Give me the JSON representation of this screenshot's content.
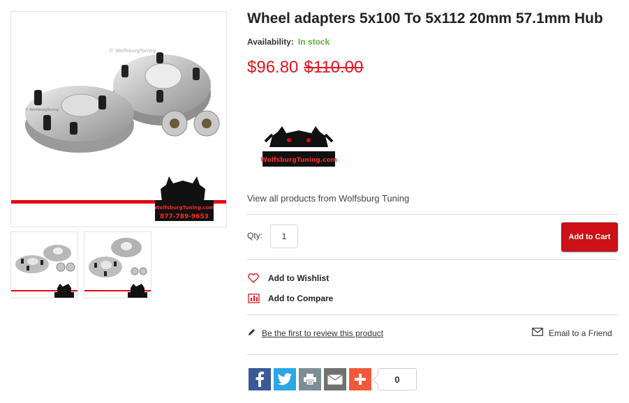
{
  "product": {
    "title": "Wheel adapters 5x100 To 5x112 20mm 57.1mm Hub",
    "availability_label": "Availability:",
    "availability_value": "In stock",
    "price": "$96.80",
    "old_price": "$110.00",
    "brand_link": "View all products from Wolfsburg Tuning"
  },
  "images": {
    "watermark": "© WolfsburgTuning",
    "logo_text": "WolfsburgTuning.com",
    "phone": "877-789-9653"
  },
  "purchase": {
    "qty_label": "Qty:",
    "qty_value": "1",
    "add_to_cart": "Add to Cart"
  },
  "actions": {
    "wishlist": "Add to Wishlist",
    "compare": "Add to Compare",
    "review": "Be the first to review this product",
    "email_friend": "Email to a Friend"
  },
  "share": {
    "count": "0"
  },
  "colors": {
    "price_red": "#e4141d",
    "stock_green": "#5cae3a",
    "cart_red": "#cc1016",
    "facebook": "#3b5998",
    "twitter": "#2aa7e4",
    "print": "#7c8d95",
    "email": "#707070",
    "plus": "#f1593a"
  },
  "icons": [
    "heart-icon",
    "chart-icon",
    "pencil-icon",
    "envelope-icon",
    "facebook-icon",
    "twitter-icon",
    "print-icon",
    "mail-icon",
    "plus-icon"
  ]
}
